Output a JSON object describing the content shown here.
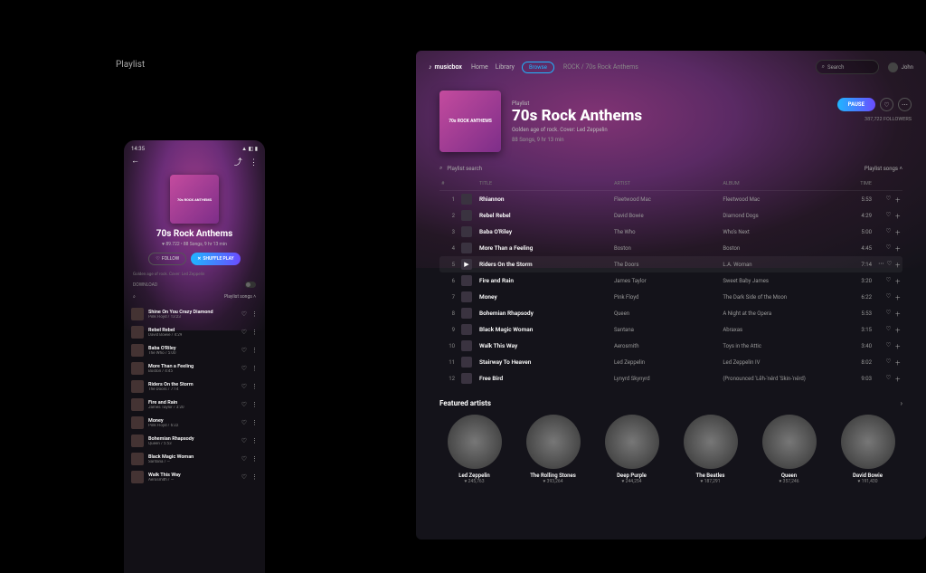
{
  "section_label": "Playlist",
  "mobile": {
    "status_time": "14:35",
    "cover_text": "70s ROCK ANTHEMS",
    "title": "70s Rock Anthems",
    "meta": "♥ 89.722 • 88 Songs, 9 hr 13 min",
    "follow": "FOLLOW",
    "shuffle": "SHUFFLE PLAY",
    "subtitle": "Golden age of rock. Cover: Led Zeppelin",
    "download_label": "DOWNLOAD",
    "playlist_songs_label": "Playlist songs",
    "tracks": [
      {
        "title": "Shine On You Crazy Diamond",
        "byline": "Pink Floyd  /  13:23"
      },
      {
        "title": "Rebel Rebel",
        "byline": "David Bowie  /  4:29"
      },
      {
        "title": "Baba O'Riley",
        "byline": "The Who  /  5:00"
      },
      {
        "title": "More Than a Feeling",
        "byline": "Boston  /  4:45"
      },
      {
        "title": "Riders On the Storm",
        "byline": "The Doors  /  7:14"
      },
      {
        "title": "Fire and Rain",
        "byline": "James Taylor  /  3:20"
      },
      {
        "title": "Money",
        "byline": "Pink Floyd  /  6:22"
      },
      {
        "title": "Bohemian Rhapsody",
        "byline": "Queen  /  5:53"
      },
      {
        "title": "Black Magic Woman",
        "byline": "Santana  /  —"
      },
      {
        "title": "Walk This Way",
        "byline": "Aerosmith  /  —"
      }
    ]
  },
  "desktop": {
    "brand": "musicbox",
    "nav": {
      "home": "Home",
      "library": "Library",
      "browse": "Browse"
    },
    "crumb_root": "ROCK",
    "crumb_sep": " / ",
    "crumb_leaf": "70s Rock Anthems",
    "search_placeholder": "Search",
    "user_name": "John",
    "cover_text": "70s ROCK ANTHEMS",
    "kicker": "Playlist",
    "title": "70s Rock Anthems",
    "subtitle": "Golden age of rock. Cover: Led Zeppelin",
    "meta": "88 Songs, 9 hr 13 min",
    "pause": "PAUSE",
    "followers": "387,722 FOLLOWERS",
    "playlist_search": "Playlist search",
    "playlist_songs_label": "Playlist songs",
    "columns": {
      "num": "#",
      "title": "TITLE",
      "artist": "ARTIST",
      "album": "ALBUM",
      "time": "TIME"
    },
    "tracks": [
      {
        "n": "1",
        "title": "Rhiannon",
        "artist": "Fleetwood Mac",
        "album": "Fleetwood Mac",
        "time": "5:53"
      },
      {
        "n": "2",
        "title": "Rebel Rebel",
        "artist": "David Bowie",
        "album": "Diamond Dogs",
        "time": "4:29"
      },
      {
        "n": "3",
        "title": "Baba O'Riley",
        "artist": "The Who",
        "album": "Who's Next",
        "time": "5:00"
      },
      {
        "n": "4",
        "title": "More Than a Feeling",
        "artist": "Boston",
        "album": "Boston",
        "time": "4:45"
      },
      {
        "n": "5",
        "title": "Riders On the Storm",
        "artist": "The Doors",
        "album": "L.A. Woman",
        "time": "7:14",
        "active": true
      },
      {
        "n": "6",
        "title": "Fire and Rain",
        "artist": "James Taylor",
        "album": "Sweet Baby James",
        "time": "3:20"
      },
      {
        "n": "7",
        "title": "Money",
        "artist": "Pink Floyd",
        "album": "The Dark Side of the Moon",
        "time": "6:22"
      },
      {
        "n": "8",
        "title": "Bohemian Rhapsody",
        "artist": "Queen",
        "album": "A Night at the Opera",
        "time": "5:53"
      },
      {
        "n": "9",
        "title": "Black Magic Woman",
        "artist": "Santana",
        "album": "Abraxas",
        "time": "3:15"
      },
      {
        "n": "10",
        "title": "Walk This Way",
        "artist": "Aerosmith",
        "album": "Toys in the Attic",
        "time": "3:40"
      },
      {
        "n": "11",
        "title": "Stairway To Heaven",
        "artist": "Led Zeppelin",
        "album": "Led Zeppelin IV",
        "time": "8:02"
      },
      {
        "n": "12",
        "title": "Free Bird",
        "artist": "Lynyrd Skynyrd",
        "album": "(Pronounced 'Lĕh-'nérd 'Skin-'nérd)",
        "time": "9:03"
      }
    ],
    "featured_title": "Featured artists",
    "artists": [
      {
        "name": "Led Zeppelin",
        "count": "♥ 245,763"
      },
      {
        "name": "The Rolling Stones",
        "count": "♥ 393,264"
      },
      {
        "name": "Deep Purple",
        "count": "♥ 244,254"
      },
      {
        "name": "The Beatles",
        "count": "♥ 187,291"
      },
      {
        "name": "Queen",
        "count": "♥ 357,246"
      },
      {
        "name": "David Bowie",
        "count": "♥ 191,430"
      }
    ]
  }
}
